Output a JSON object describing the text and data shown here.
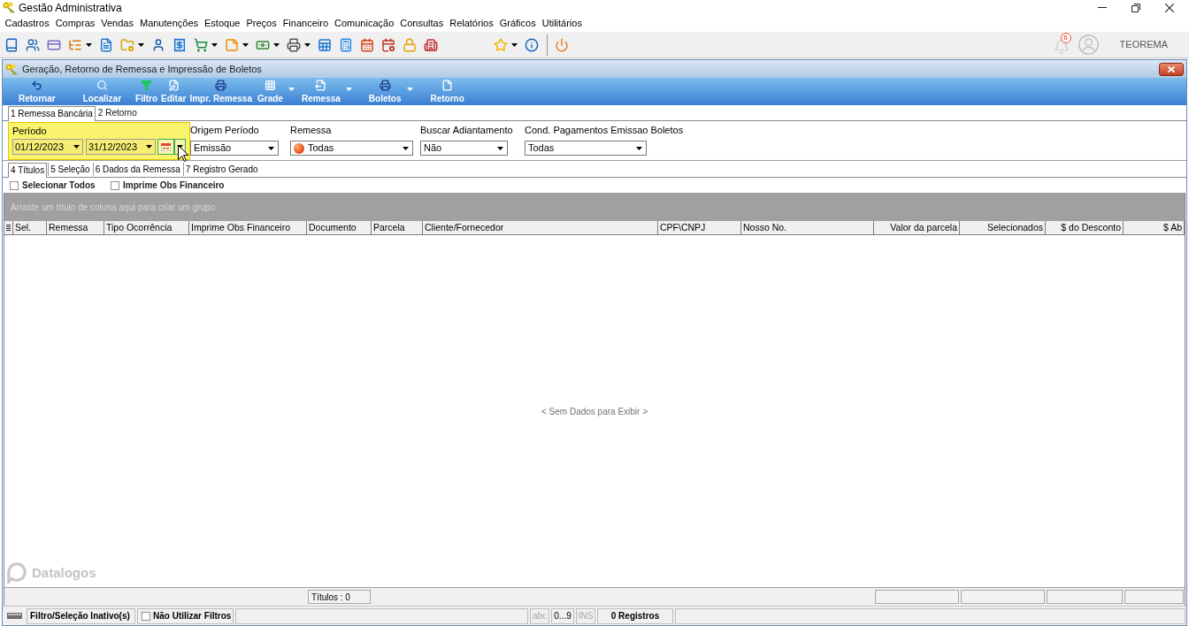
{
  "window": {
    "title": "Gestão Administrativa"
  },
  "menu": [
    "Cadastros",
    "Compras",
    "Vendas",
    "Manutenções",
    "Estoque",
    "Preços",
    "Financeiro",
    "Comunicação",
    "Consultas",
    "Relatórios",
    "Gráficos",
    "Utilitários"
  ],
  "toolbar": {
    "groups": [
      [
        {
          "dropdown": false
        },
        {
          "dropdown": false
        },
        {
          "dropdown": false
        },
        {
          "dropdown": true
        },
        {
          "dropdown": false
        },
        {
          "dropdown": true
        },
        {
          "dropdown": false
        },
        {
          "dropdown": false
        },
        {
          "dropdown": true
        },
        {
          "dropdown": true
        },
        {
          "dropdown": true
        },
        {
          "dropdown": true
        },
        {
          "dropdown": false
        },
        {
          "dropdown": false
        },
        {
          "dropdown": false
        },
        {
          "dropdown": false
        },
        {
          "dropdown": false
        },
        {
          "dropdown": false
        }
      ],
      [
        {
          "dropdown": true
        },
        {
          "dropdown": false
        }
      ],
      [
        {
          "dropdown": false
        }
      ]
    ]
  },
  "notifications": {
    "count": "0"
  },
  "user": {
    "name": "TEOREMA"
  },
  "child_window": {
    "title": "Geração, Retorno de Remessa e Impressão de Boletos"
  },
  "actions": [
    {
      "label": "Retornar",
      "dropdown": false
    },
    {
      "label": "Localizar",
      "dropdown": false
    },
    {
      "label": "Filtro",
      "dropdown": false
    },
    {
      "label": "Editar",
      "dropdown": false
    },
    {
      "label": "Impr. Remessa",
      "dropdown": false
    },
    {
      "label": "Grade",
      "dropdown": true
    },
    {
      "label": "Remessa",
      "dropdown": true
    },
    {
      "label": "Boletos",
      "dropdown": true
    },
    {
      "label": "Retorno",
      "dropdown": false
    }
  ],
  "tabs": [
    {
      "label": "1 Remessa Bancária",
      "selected": true
    },
    {
      "label": "2 Retorno",
      "selected": false
    }
  ],
  "period": {
    "label": "Período",
    "highlighted": true,
    "from": "01/12/2023",
    "to": "31/12/2023"
  },
  "filters": [
    {
      "label": "Origem Período",
      "value": "Emissão",
      "kind": "select"
    },
    {
      "label": "Remessa",
      "value": "Todas",
      "kind": "status_select"
    },
    {
      "label": "Buscar Adiantamento",
      "value": "Não",
      "kind": "select"
    },
    {
      "label": "Cond. Pagamentos Emissao Boletos",
      "value": "Todas",
      "kind": "select"
    }
  ],
  "sub_tabs": [
    {
      "label": "4 Títulos",
      "selected": true
    },
    {
      "label": "5 Seleção",
      "selected": false
    },
    {
      "label": "6 Dados da Remessa",
      "selected": false
    },
    {
      "label": "7 Registro Gerado",
      "selected": false
    }
  ],
  "options": [
    {
      "label": "Selecionar Todos",
      "checked": false
    },
    {
      "label": "Imprime Obs Financeiro",
      "checked": false
    }
  ],
  "grid": {
    "group_hint": "Arraste um título de coluna aqui para criar um grupo",
    "columns": [
      {
        "label": "Sel.",
        "kind": "text"
      },
      {
        "label": "Remessa",
        "kind": "text"
      },
      {
        "label": "Tipo Ocorrência",
        "kind": "text"
      },
      {
        "label": "Imprime Obs Financeiro",
        "kind": "text"
      },
      {
        "label": "Documento",
        "kind": "text",
        "total_box": true,
        "summary": "Títulos : 0"
      },
      {
        "label": "Parcela",
        "kind": "text"
      },
      {
        "label": "Cliente/Fornecedor",
        "kind": "text"
      },
      {
        "label": "CPF\\CNPJ",
        "kind": "text"
      },
      {
        "label": "Nosso No.",
        "kind": "text"
      },
      {
        "label": "Valor da parcela",
        "kind": "number",
        "total_box": true
      },
      {
        "label": "Selecionados",
        "kind": "number",
        "total_box": true
      },
      {
        "label": "$ do Desconto",
        "kind": "number",
        "total_box": true
      },
      {
        "label": "$ Ab",
        "kind": "number",
        "total_box": true
      }
    ],
    "empty_text": "< Sem Dados para Exibir >",
    "brand": "Datalogos"
  },
  "status_bar": {
    "filter_status": "Filtro/Seleção Inativo(s)",
    "no_filters": {
      "label": "Não Utilizar Filtros",
      "checked": false
    },
    "indicators": [
      {
        "label": "abc",
        "active": false
      },
      {
        "label": "0...9",
        "active": true
      },
      {
        "label": "INS",
        "active": false
      }
    ],
    "records": "0 Registros"
  }
}
